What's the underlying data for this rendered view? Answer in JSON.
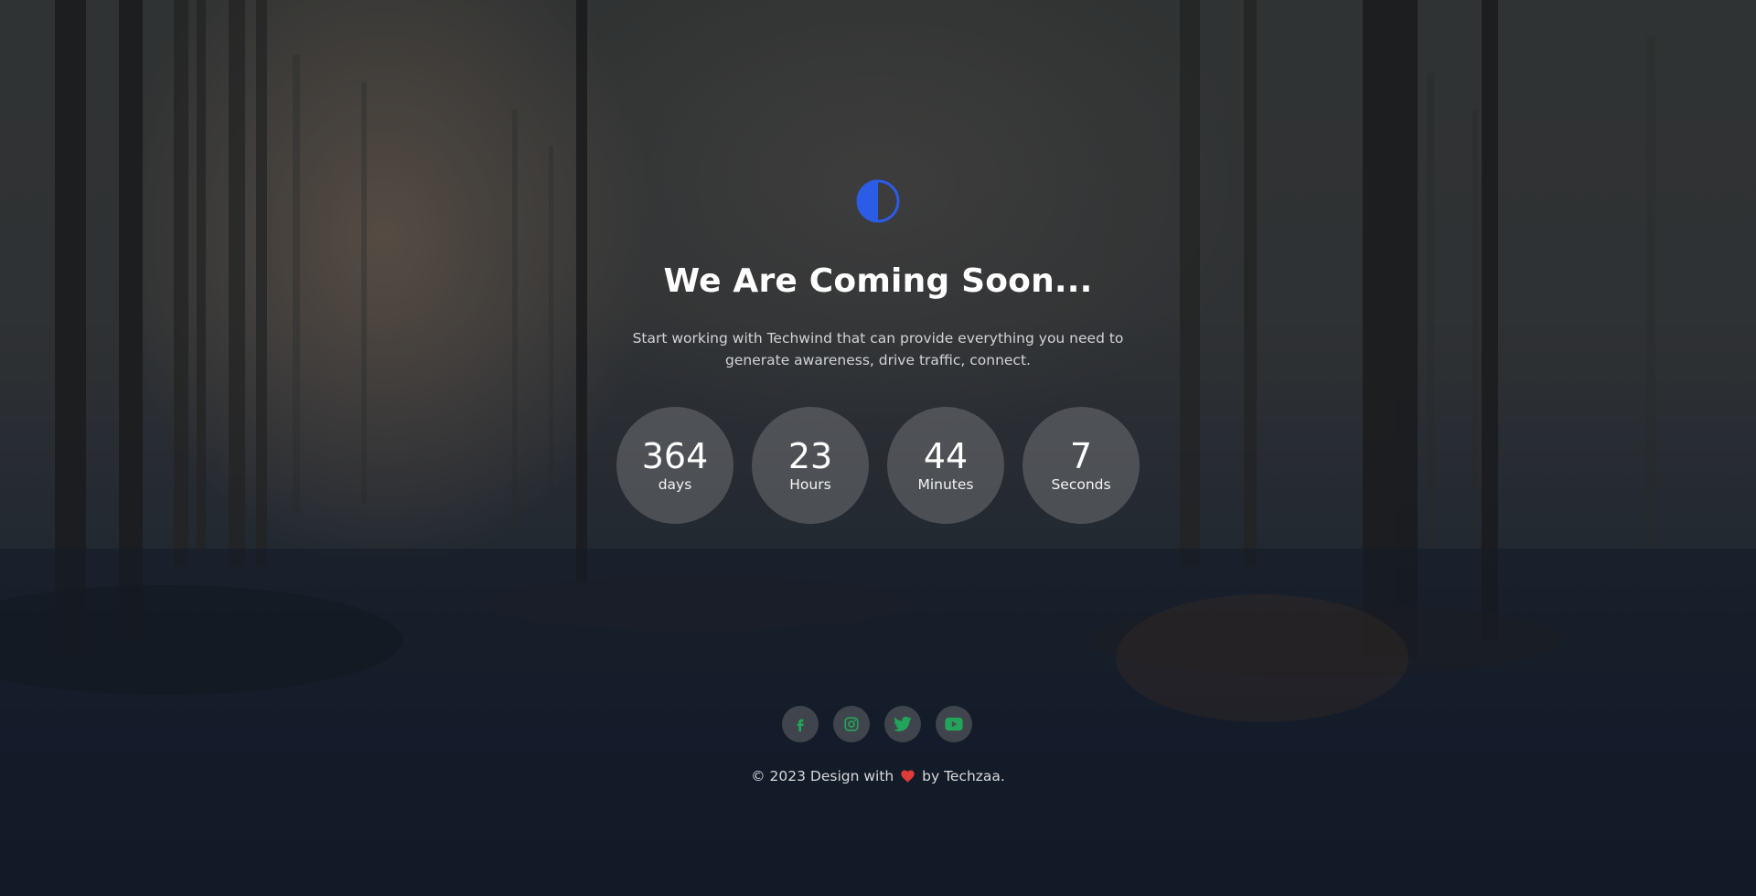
{
  "hero": {
    "title": "We Are Coming Soon...",
    "subtitle": "Start working with Techwind that can provide everything you need to generate awareness, drive traffic, connect."
  },
  "logo": {
    "icon": "half-circle-logo-icon",
    "color": "#2b5ce6"
  },
  "countdown": [
    {
      "value": "364",
      "label": "days"
    },
    {
      "value": "23",
      "label": "Hours"
    },
    {
      "value": "44",
      "label": "Minutes"
    },
    {
      "value": "7",
      "label": "Seconds"
    }
  ],
  "social": [
    {
      "icon": "facebook-icon"
    },
    {
      "icon": "instagram-icon"
    },
    {
      "icon": "twitter-icon"
    },
    {
      "icon": "youtube-icon"
    }
  ],
  "footer": {
    "prefix": "© 2023 Design with",
    "suffix": "by Techzaa.",
    "heart_icon": "heart-icon"
  },
  "colors": {
    "accent": "#2b5ce6",
    "social_icon": "#22a55a",
    "heart": "#e03b3b"
  }
}
